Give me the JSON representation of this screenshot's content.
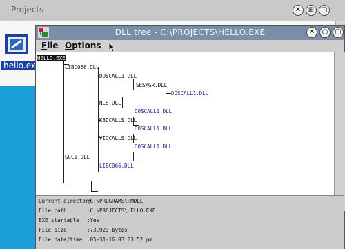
{
  "background_window": {
    "title": "Projects",
    "file_icon": "executable-file-icon",
    "file_label": "hello.exe"
  },
  "window": {
    "title": "DLL tree - C:\\PROJECTS\\HELLO.EXE",
    "system_icon": "dll-tree-app-icon",
    "menu": {
      "file": "File",
      "options": "Options"
    }
  },
  "tree": {
    "root": "HELLO.EXE",
    "nodes": {
      "libc066": "LIBC066.DLL",
      "doscall1_a": "DOSCALL1.DLL",
      "sesmgr": "SESMGR.DLL",
      "doscall1_b": "DOSCALL1.DLL",
      "nls": "NLS.DLL",
      "doscall1_c": "DOSCALL1.DLL",
      "kbdcalls": "KBDCALLS.DLL",
      "doscall1_d": "DOSCALL1.DLL",
      "viocalls": "VIOCALLS.DLL",
      "doscall1_e": "DOSCALL1.DLL",
      "gcc1": "GCC1.DLL",
      "libc066_leaf": "LIBC066.DLL"
    }
  },
  "info": {
    "current_directory_label": "Current directory",
    "current_directory": "C:\\PROGRAMS\\PMDLL",
    "file_path_label": "File path",
    "file_path": "C:\\PROJECTS\\HELLO.EXE",
    "exe_startable_label": "EXE startable",
    "exe_startable": "Yes",
    "file_size_label": "File size",
    "file_size": "73,923 bytes",
    "file_datetime_label": "File date/time",
    "file_datetime": "05-31-16 03:03:52 pm"
  },
  "colors": {
    "desktop": "#1a9fd7",
    "titlebar": "#7a8ea8",
    "selection": "#1a3fa6",
    "leaf_text": "#1a2a8a"
  }
}
